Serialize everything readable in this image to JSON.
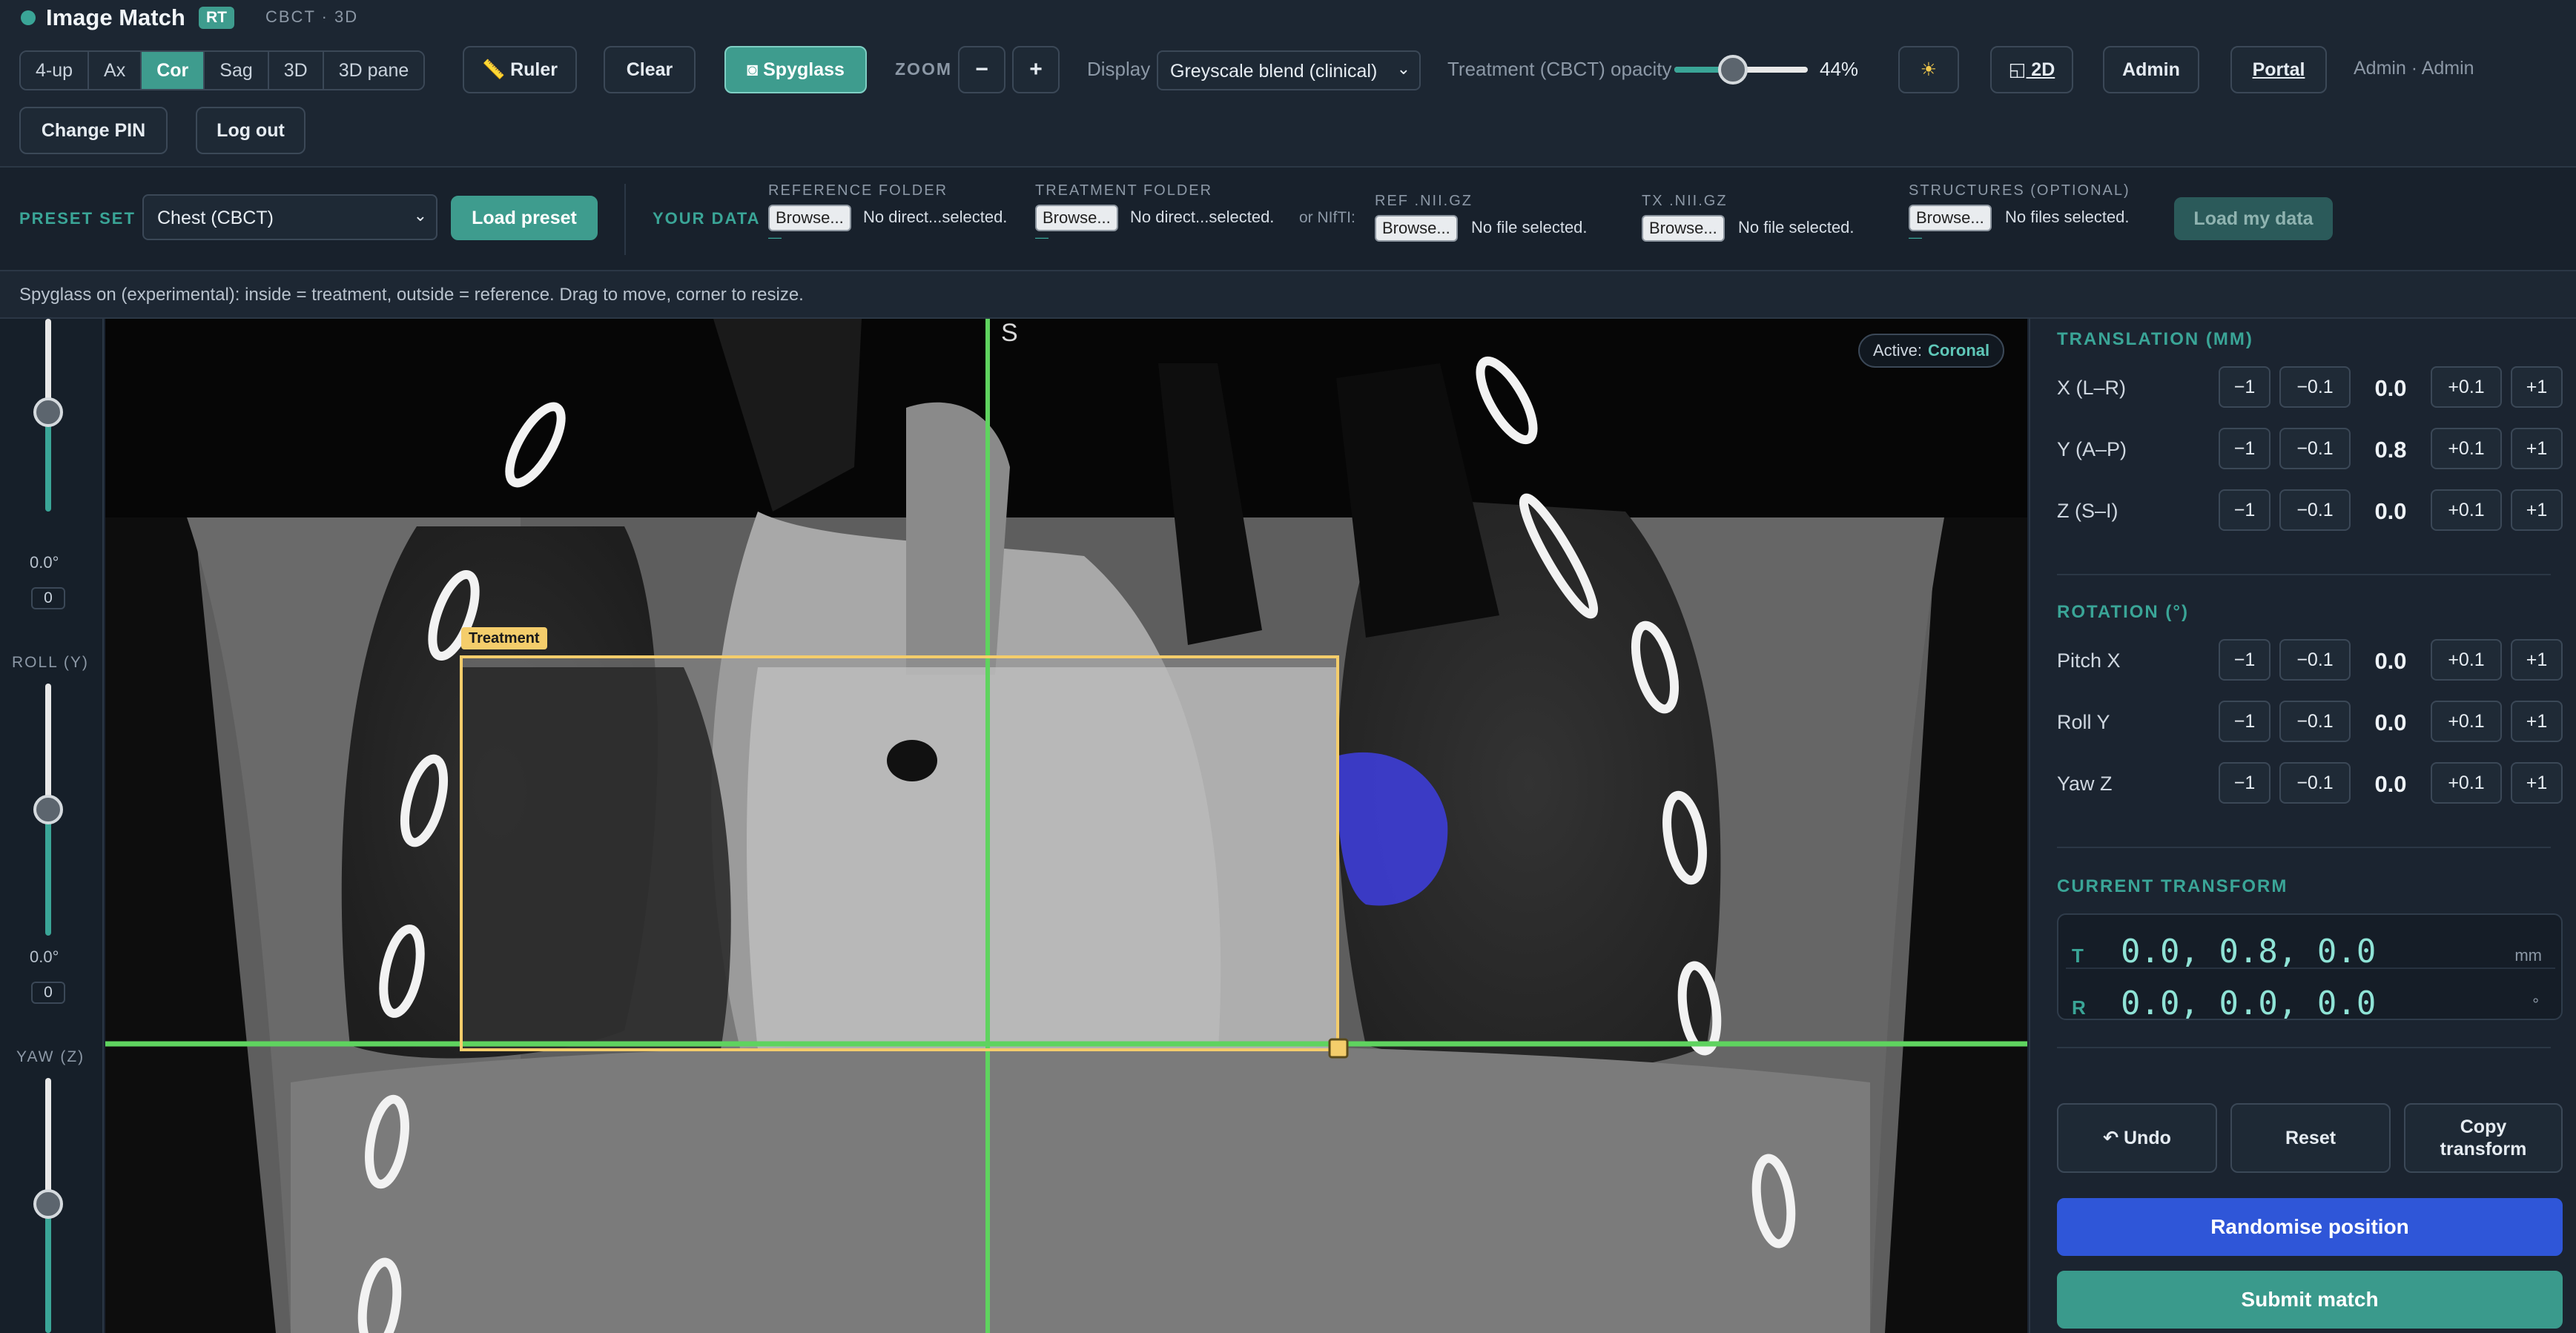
{
  "app": {
    "title": "Image Match",
    "badge": "RT",
    "subtitle": "CBCT · 3D",
    "status_color": "#3aa597"
  },
  "toolbar": {
    "view_modes": [
      "4-up",
      "Ax",
      "Cor",
      "Sag",
      "3D",
      "3D pane"
    ],
    "active_view": "Cor",
    "ruler_label": "📏 Ruler",
    "clear_label": "Clear",
    "spyglass_label": "◙ Spyglass",
    "zoom_label": "ZOOM",
    "zoom_out": "−",
    "zoom_in": "+",
    "display_label": "Display",
    "display_value": "Greyscale blend (clinical)",
    "opacity_label": "Treatment (CBCT) opacity",
    "opacity_value": "44%",
    "opacity_fraction": 0.44,
    "sun_icon": "☀",
    "mode_2d_label": "◱ 2D",
    "admin_label": "Admin",
    "portal_label": "Portal",
    "user_label": "Admin · Admin",
    "change_pin_label": "Change PIN",
    "logout_label": "Log out"
  },
  "preset": {
    "label": "PRESET SET",
    "selected": "Chest (CBCT)",
    "load_label": "Load preset",
    "your_data_label": "YOUR DATA",
    "reference_folder_label": "REFERENCE FOLDER",
    "treatment_folder_label": "TREATMENT FOLDER",
    "browse_label": "Browse...",
    "no_directory": "No direct...selected.",
    "or_nifti": "or NIfTI:",
    "ref_nii_label": "REF .NII.GZ",
    "tx_nii_label": "TX .NII.GZ",
    "no_file": "No file selected.",
    "structures_label": "STRUCTURES (OPTIONAL)",
    "no_files": "No files selected.",
    "load_my_data_label": "Load my data",
    "dash": "—"
  },
  "hint": {
    "text": "Spyglass on (experimental): inside = treatment, outside = reference. Drag to move, corner to resize."
  },
  "left_sliders": {
    "pitch_value": "0.0°",
    "pitch_box": "0",
    "roll_label": "ROLL (Y)",
    "roll_value": "0.0°",
    "roll_box": "0",
    "yaw_label": "YAW (Z)"
  },
  "viewer": {
    "orientation_marker": "S",
    "active_label": "Active:",
    "active_value": "Coronal",
    "spyglass_tag": "Treatment",
    "crosshair_color": "#5fd35f"
  },
  "translation": {
    "title": "TRANSLATION (MM)",
    "rows": [
      {
        "label": "X (L–R)",
        "value": "0.0"
      },
      {
        "label": "Y (A–P)",
        "value": "0.8"
      },
      {
        "label": "Z (S–I)",
        "value": "0.0"
      }
    ]
  },
  "rotation": {
    "title": "ROTATION (°)",
    "rows": [
      {
        "label": "Pitch X",
        "value": "0.0"
      },
      {
        "label": "Roll Y",
        "value": "0.0"
      },
      {
        "label": "Yaw Z",
        "value": "0.0"
      }
    ]
  },
  "steps": [
    "−1",
    "−0.1",
    "+0.1",
    "+1"
  ],
  "transform": {
    "title": "CURRENT TRANSFORM",
    "t_label": "T",
    "t_value": "0.0, 0.8, 0.0",
    "t_unit": "mm",
    "r_label": "R",
    "r_value": "0.0, 0.0, 0.0",
    "r_unit": "°"
  },
  "actions": {
    "undo_label": "↶ Undo",
    "reset_label": "Reset",
    "copy_label_1": "Copy",
    "copy_label_2": "transform",
    "randomise_label": "Randomise position",
    "submit_label": "Submit match"
  }
}
